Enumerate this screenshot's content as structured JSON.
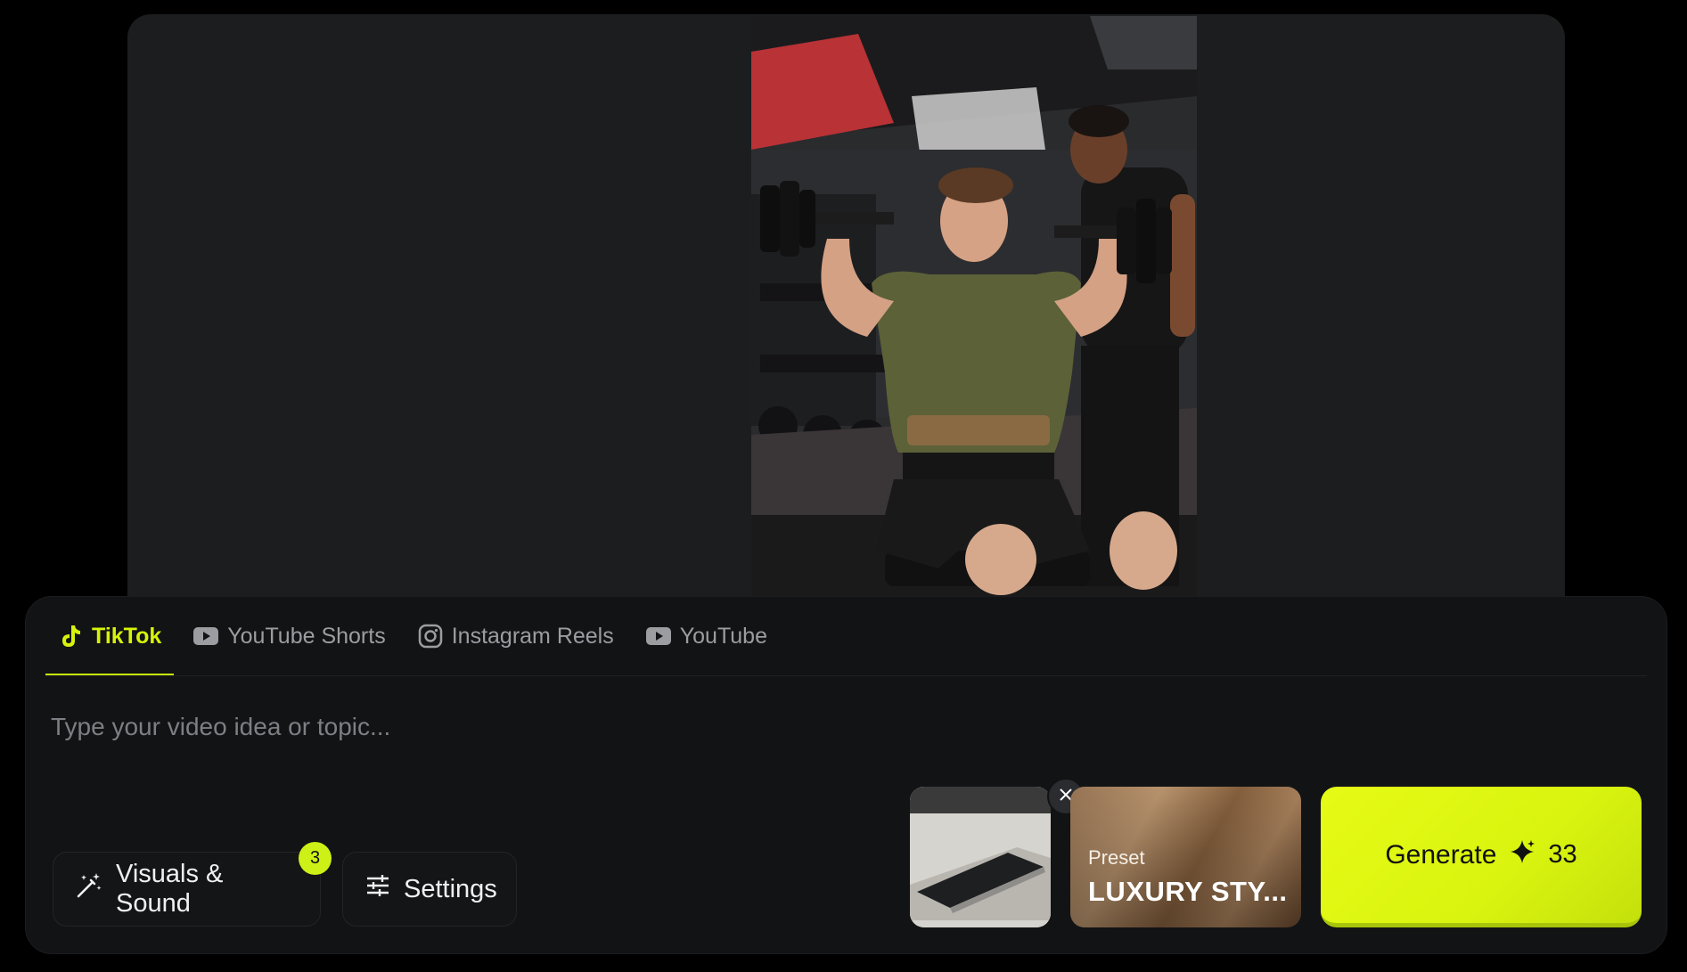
{
  "video": {
    "description_icon": "video-preview"
  },
  "tabs": [
    {
      "label": "TikTok",
      "icon": "tiktok-icon",
      "active": true
    },
    {
      "label": "YouTube Shorts",
      "icon": "youtube-icon",
      "active": false
    },
    {
      "label": "Instagram Reels",
      "icon": "instagram-icon",
      "active": false
    },
    {
      "label": "YouTube",
      "icon": "youtube-icon",
      "active": false
    }
  ],
  "prompt": {
    "placeholder": "Type your video idea or topic..."
  },
  "toolbar": {
    "visuals_label": "Visuals & Sound",
    "visuals_badge": "3",
    "settings_label": "Settings"
  },
  "preset": {
    "label": "Preset",
    "name": "LUXURY STY..."
  },
  "generate": {
    "label": "Generate",
    "credits": "33"
  },
  "colors": {
    "accent": "#d7f20b",
    "panel_bg": "#121315",
    "stage_bg": "#1c1d1f"
  }
}
